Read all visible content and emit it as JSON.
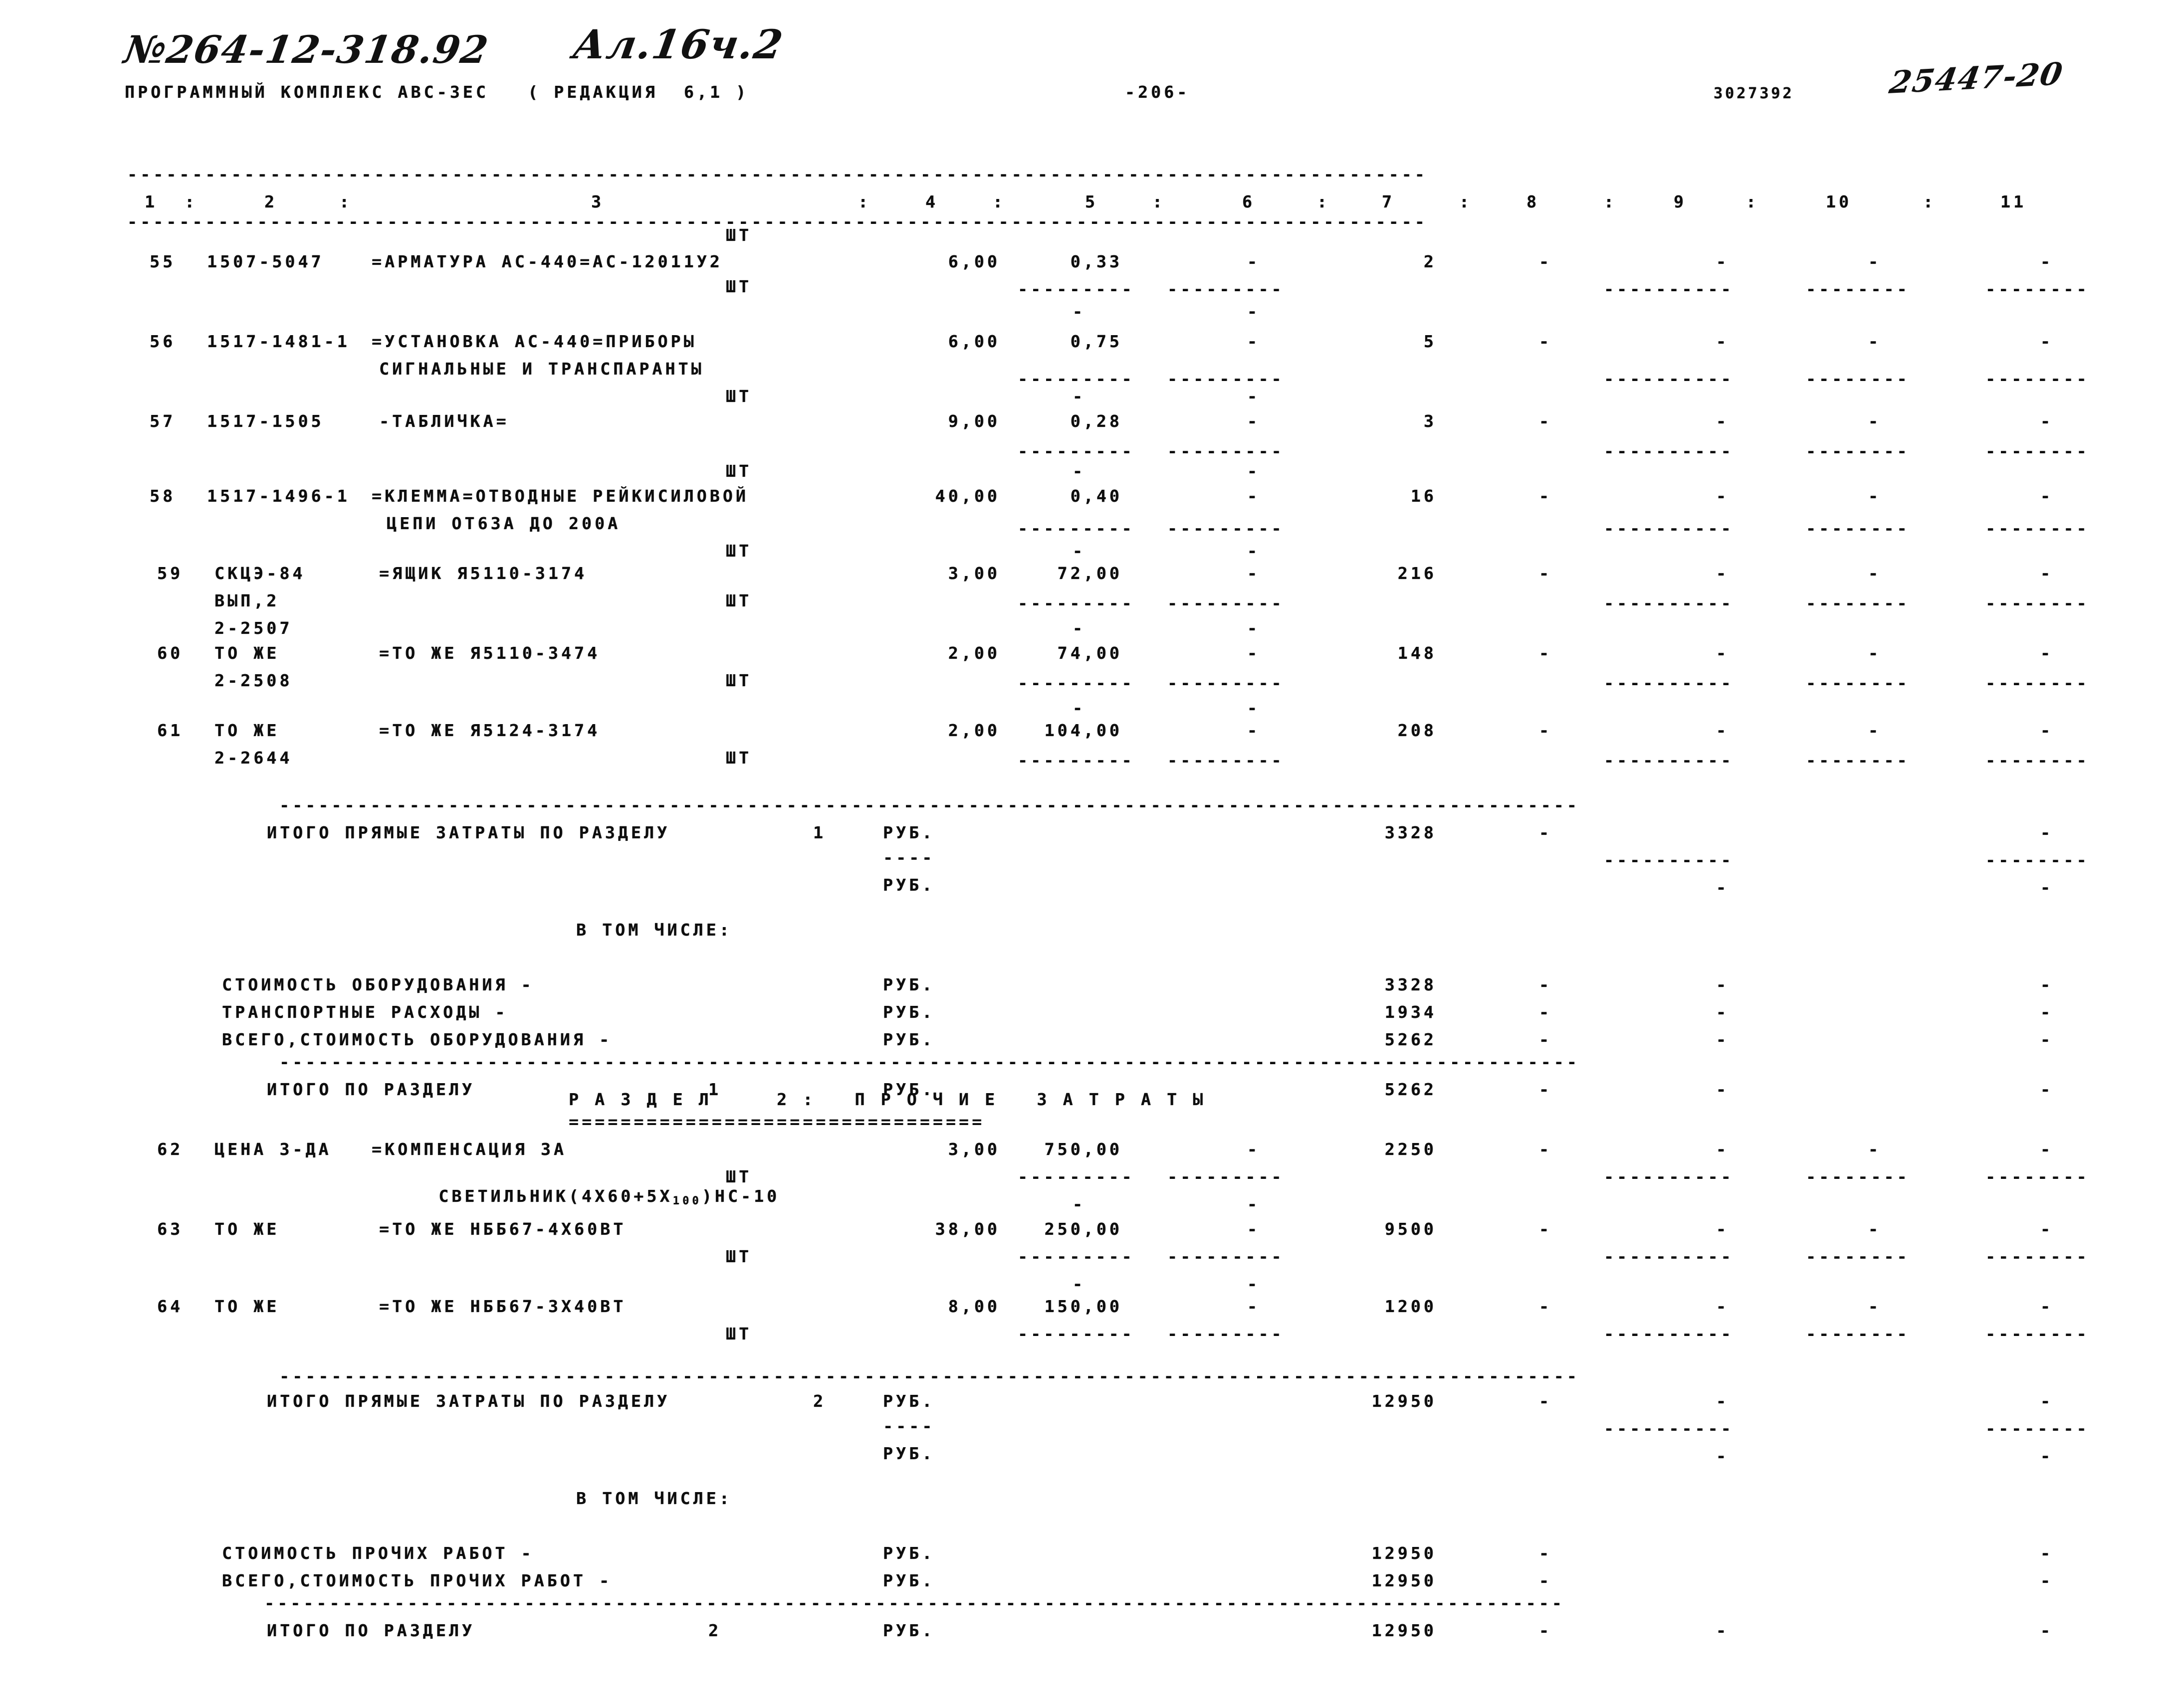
{
  "header": {
    "handwritten_code": "№264-12-318.92",
    "handwritten_sheet": "Ал.16ч.2",
    "handwritten_right": "25447-20",
    "program_line": "ПРОГРАММНЫЙ КОМПЛЕКС АВС-ЗЕС   ( РЕДАКЦИЯ  6,1 )",
    "page_number": "-206-",
    "doc_number": "3027392"
  },
  "columns": {
    "labels": [
      "1",
      "2",
      "3",
      "4",
      "5",
      "6",
      "7",
      "8",
      "9",
      "10",
      "11"
    ],
    "separator": ":"
  },
  "rows": [
    {
      "no": "55",
      "code": "1507-5047",
      "name": "=АРМАТУРА АС-440=АС-12011У2",
      "unit": "ШТ",
      "qty": "6,00",
      "price": "0,33",
      "col6": "-",
      "total": "2",
      "col8": "-",
      "col9": "-",
      "col10": "-",
      "col11": "-"
    },
    {
      "no": "56",
      "code": "1517-1481-1",
      "name": "=УСТАНОВКА АС-440=ПРИБОРЫ",
      "name2": "СИГНАЛЬНЫЕ И ТРАНСПАРАНТЫ",
      "unit": "ШТ",
      "qty": "6,00",
      "price": "0,75",
      "col6": "-",
      "total": "5",
      "col8": "-",
      "col9": "-",
      "col10": "-",
      "col11": "-"
    },
    {
      "no": "57",
      "code": "1517-1505",
      "name": "-ТАБЛИЧКА=",
      "unit": "ШТ",
      "qty": "9,00",
      "price": "0,28",
      "col6": "-",
      "total": "3",
      "col8": "-",
      "col9": "-",
      "col10": "-",
      "col11": "-"
    },
    {
      "no": "58",
      "code": "1517-1496-1",
      "name": "=КЛЕММА=ОТВОДНЫЕ РЕЙКИСИЛОВОЙ",
      "name2": "ЦЕПИ ОТ63А ДО 200А",
      "unit": "ШТ",
      "qty": "40,00",
      "price": "0,40",
      "col6": "-",
      "total": "16",
      "col8": "-",
      "col9": "-",
      "col10": "-",
      "col11": "-"
    },
    {
      "no": "59",
      "code": "СКЦЭ-84",
      "code2": "ВЫП,2",
      "code3": "2-2507",
      "name": "=ЯЩИК Я5110-3174",
      "unit": "ШТ",
      "qty": "3,00",
      "price": "72,00",
      "col6": "-",
      "total": "216",
      "col8": "-",
      "col9": "-",
      "col10": "-",
      "col11": "-"
    },
    {
      "no": "60",
      "code": "ТО ЖЕ",
      "code3": "2-2508",
      "name": "=ТО ЖЕ Я5110-3474",
      "unit": "ШТ",
      "qty": "2,00",
      "price": "74,00",
      "col6": "-",
      "total": "148",
      "col8": "-",
      "col9": "-",
      "col10": "-",
      "col11": "-"
    },
    {
      "no": "61",
      "code": "ТО ЖЕ",
      "code3": "2-2644",
      "name": "=ТО ЖЕ Я5124-3174",
      "unit": "ШТ",
      "qty": "2,00",
      "price": "104,00",
      "col6": "-",
      "total": "208",
      "col8": "-",
      "col9": "-",
      "col10": "-",
      "col11": "-"
    }
  ],
  "section1_totals": {
    "direct_label": "ИТОГО ПРЯМЫЕ ЗАТРАТЫ ПО РАЗДЕЛУ",
    "direct_section": "1",
    "direct_unit": "РУБ.",
    "direct_value": "3328",
    "unit2": "РУБ.",
    "including_label": "В ТОМ ЧИСЛЕ:",
    "lines": [
      {
        "label": "СТОИМОСТЬ ОБОРУДОВАНИЯ -",
        "unit": "РУБ.",
        "value": "3328"
      },
      {
        "label": "ТРАНСПОРТНЫЕ РАСХОДЫ -",
        "unit": "РУБ.",
        "value": "1934"
      },
      {
        "label": "ВСЕГО,СТОИМОСТЬ ОБОРУДОВАНИЯ -",
        "unit": "РУБ.",
        "value": "5262"
      }
    ],
    "total_label": "ИТОГО ПО РАЗДЕЛУ",
    "total_section": "1",
    "total_unit": "РУБ.",
    "total_value": "5262"
  },
  "section2": {
    "heading": "Р А З Д Е Л     2 :   П Р О Ч И Е   З А Т Р А Т Ы",
    "rows": [
      {
        "no": "62",
        "code": "ЦЕНА З-ДА",
        "name": "=КОМПЕНСАЦИЯ ЗА",
        "name2_a": "СВЕТИЛЬНИК(4Х60+5Х",
        "name2_sub": "100",
        "name2_b": ")НС-10",
        "unit": "ШТ",
        "qty": "3,00",
        "price": "750,00",
        "col6": "-",
        "total": "2250",
        "col8": "-",
        "col9": "-",
        "col10": "-",
        "col11": "-"
      },
      {
        "no": "63",
        "code": "ТО ЖЕ",
        "name": "=ТО ЖЕ НББ67-4Х60ВТ",
        "unit": "ШТ",
        "qty": "38,00",
        "price": "250,00",
        "col6": "-",
        "total": "9500",
        "col8": "-",
        "col9": "-",
        "col10": "-",
        "col11": "-"
      },
      {
        "no": "64",
        "code": "ТО ЖЕ",
        "name": "=ТО ЖЕ НББ67-3Х40ВТ",
        "unit": "ШТ",
        "qty": "8,00",
        "price": "150,00",
        "col6": "-",
        "total": "1200",
        "col8": "-",
        "col9": "-",
        "col10": "-",
        "col11": "-"
      }
    ],
    "totals": {
      "direct_label": "ИТОГО ПРЯМЫЕ ЗАТРАТЫ ПО РАЗДЕЛУ",
      "direct_section": "2",
      "direct_unit": "РУБ.",
      "direct_value": "12950",
      "unit2": "РУБ.",
      "including_label": "В ТОМ ЧИСЛЕ:",
      "lines": [
        {
          "label": "СТОИМОСТЬ ПРОЧИХ РАБОТ -",
          "unit": "РУБ.",
          "value": "12950"
        },
        {
          "label": "ВСЕГО,СТОИМОСТЬ ПРОЧИХ РАБОТ -",
          "unit": "РУБ.",
          "value": "12950"
        }
      ],
      "total_label": "ИТОГО ПО РАЗДЕЛУ",
      "total_section": "2",
      "total_unit": "РУБ.",
      "total_value": "12950"
    }
  },
  "rules": {
    "full": "----------------------------------------------------------------------------------------------------",
    "eq": "================================",
    "short_price": "---------",
    "short_col6": "---------",
    "short_right9": "----------",
    "short_right10": "--------",
    "short_right11": "--------",
    "dash4": "----"
  }
}
